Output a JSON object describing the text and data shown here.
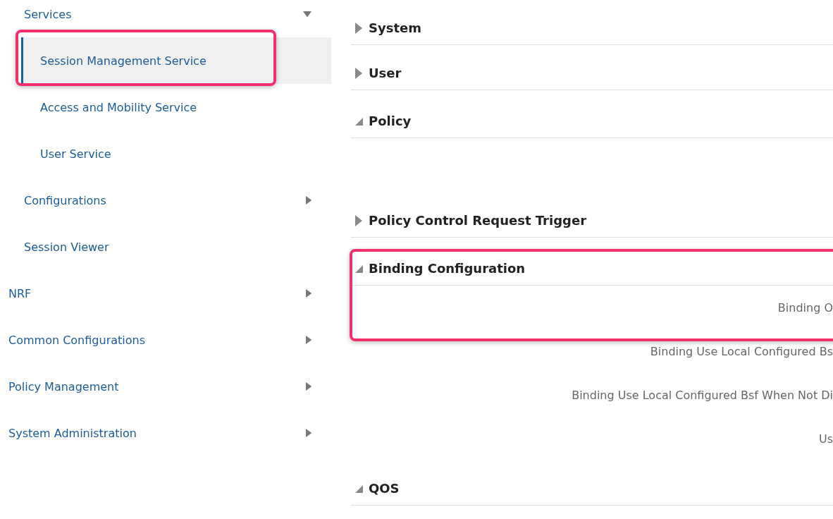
{
  "sidebar": {
    "items": [
      {
        "children": [
          {
            "label": "Services",
            "expanded": true,
            "selected": false,
            "children": [
              {
                "label": "Session Management Service",
                "selected": true,
                "highlighted": true
              },
              {
                "label": "Access and Mobility Service",
                "selected": false
              },
              {
                "label": "User Service",
                "selected": false
              }
            ]
          },
          {
            "label": "Configurations",
            "expanded": false,
            "selected": false
          },
          {
            "label": "Session Viewer",
            "selected": false
          }
        ]
      },
      {
        "label": "NRF",
        "expanded": false,
        "selected": false
      },
      {
        "label": "Common Configurations",
        "expanded": false,
        "selected": false
      },
      {
        "label": "Policy Management",
        "expanded": false,
        "selected": false
      },
      {
        "label": "System Administration",
        "expanded": false,
        "selected": false
      }
    ]
  },
  "sections": [
    {
      "title": "System",
      "expanded": false
    },
    {
      "title": "User",
      "expanded": false
    },
    {
      "title": "Policy",
      "expanded": true
    },
    {
      "title": "Policy Control Request Trigger",
      "expanded": false
    },
    {
      "title": "Binding Configuration",
      "expanded": true,
      "highlighted": true,
      "fields": [
        "Binding O",
        "Binding Use Local Configured Bs",
        "Binding Use Local Configured Bsf When Not Di",
        "Us"
      ]
    },
    {
      "title": "QOS",
      "expanded": true
    }
  ]
}
